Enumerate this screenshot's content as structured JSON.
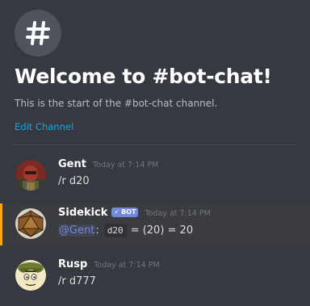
{
  "channel": {
    "welcome_title": "Welcome to #bot-chat!",
    "welcome_subtitle": "This is the start of the #bot-chat channel.",
    "edit_label": "Edit Channel"
  },
  "colors": {
    "background": "#36393f",
    "link": "#00b0f4",
    "bot_tag": "#7289da",
    "mention_bar": "#faa61a"
  },
  "messages": [
    {
      "username": "Gent",
      "timestamp": "Today at 7:14 PM",
      "content": "/r d20",
      "avatar_icon": "red-masked-figure-avatar"
    },
    {
      "username": "Sidekick",
      "bot_tag": "BOT",
      "timestamp": "Today at 7:14 PM",
      "mention": "@Gent",
      "mention_suffix": ":",
      "code": "d20",
      "result": "= (20) = 20",
      "avatar_icon": "d20-die-avatar"
    },
    {
      "username": "Rusp",
      "timestamp": "Today at 7:14 PM",
      "content": "/r d777",
      "avatar_icon": "cartoon-soldier-avatar"
    }
  ]
}
